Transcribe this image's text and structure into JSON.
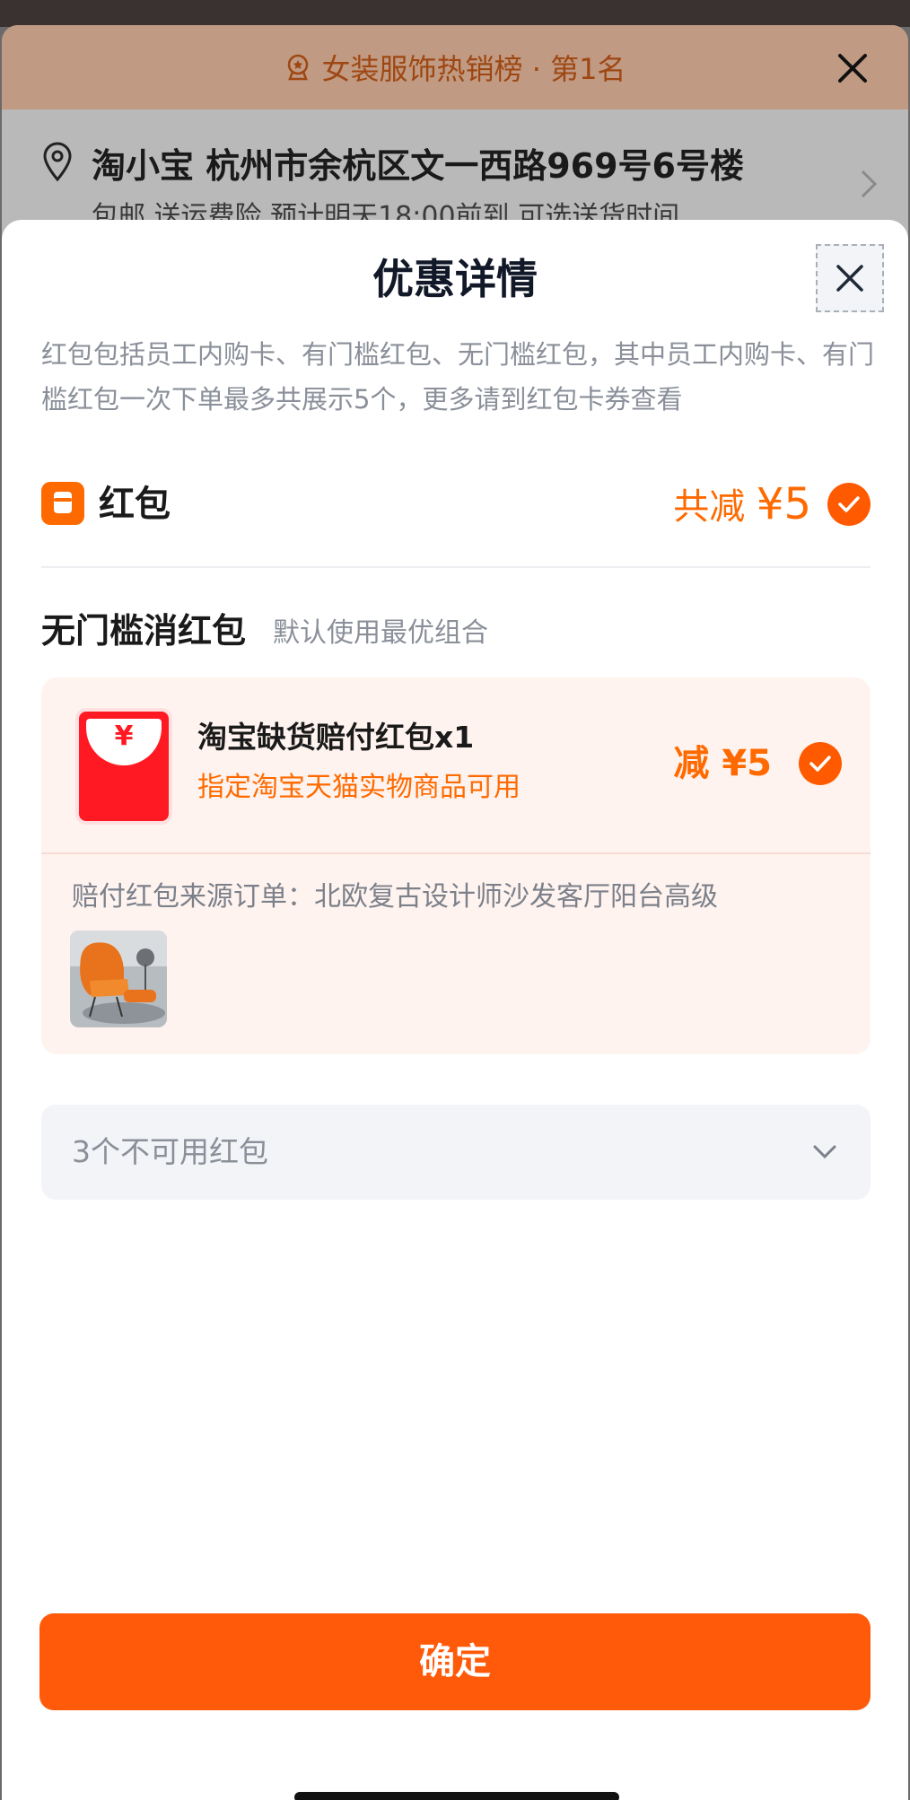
{
  "background": {
    "banner_text": "女装服饰热销榜 · 第1名",
    "address_name": "淘小宝  杭州市余杭区文一西路969号6号楼",
    "shipping_line": "包邮  送运费险  预计明天18:00前到  可选送货时间"
  },
  "modal": {
    "title": "优惠详情",
    "description": "红包包括员工内购卡、有门槛红包、无门槛红包，其中员工内购卡、有门槛红包一次下单最多共展示5个，更多请到红包卡券查看",
    "hongbao": {
      "label": "红包",
      "total_prefix": "共减 ",
      "total_amount": "¥5"
    },
    "section": {
      "title": "无门槛消红包",
      "subtitle": "默认使用最优组合"
    },
    "card": {
      "envelope_symbol": "¥",
      "name": "淘宝缺货赔付红包x1",
      "condition": "指定淘宝天猫实物商品可用",
      "amount": "减 ¥5",
      "source": "赔付红包来源订单：北欧复古设计师沙发客厅阳台高级"
    },
    "unavailable": "3个不可用红包",
    "confirm": "确定"
  },
  "colors": {
    "accent": "#ff5a0a",
    "accent_text": "#ff6a00",
    "card_bg": "#fff3ef",
    "muted_text": "#8a8f99"
  },
  "icons": [
    "badge-icon",
    "close-icon",
    "location-pin-icon",
    "chevron-right-icon",
    "hongbao-icon",
    "check-icon",
    "red-envelope-icon",
    "chevron-down-icon"
  ]
}
